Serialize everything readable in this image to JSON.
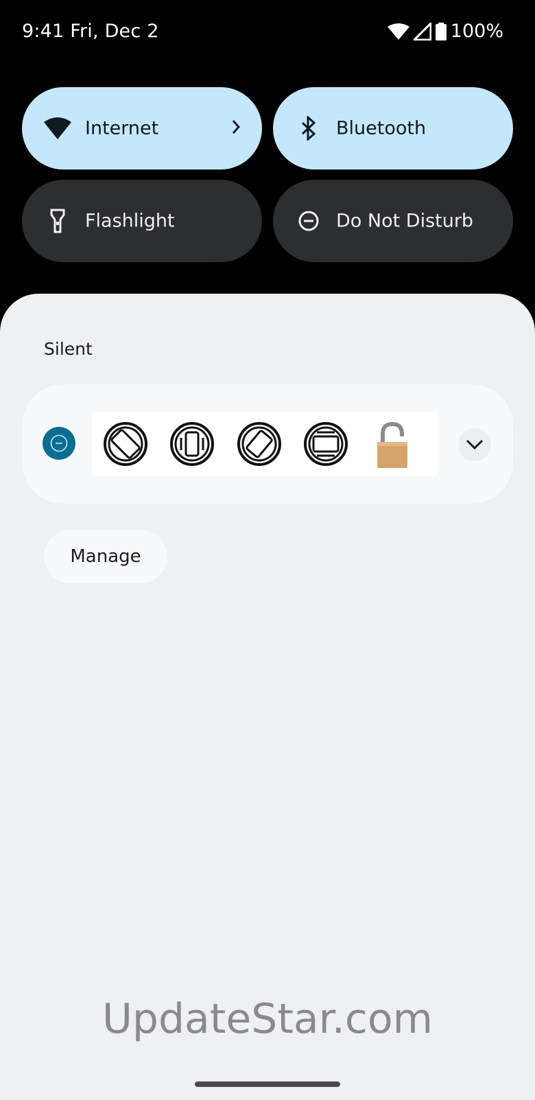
{
  "status_bar": {
    "time": "9:41",
    "date": "Fri, Dec 2",
    "battery": "100%"
  },
  "quick_settings": [
    {
      "label": "Internet",
      "state": "on",
      "icon": "wifi-icon",
      "has_chevron": true
    },
    {
      "label": "Bluetooth",
      "state": "on",
      "icon": "bluetooth-icon"
    },
    {
      "label": "Flashlight",
      "state": "off",
      "icon": "flashlight-icon"
    },
    {
      "label": "Do Not Disturb",
      "state": "off",
      "icon": "do-not-disturb-icon"
    }
  ],
  "notifications": {
    "section_label": "Silent",
    "card": {
      "app_icon": "do-not-disturb-icon",
      "image_icons": [
        "rotate-icon",
        "vibrate-icon",
        "rotate-alt-icon",
        "screen-icon",
        "padlock-icon"
      ],
      "expand_icon": "chevron-down-icon"
    },
    "manage_label": "Manage"
  },
  "watermark": "UpdateStar.com",
  "colors": {
    "tile_on": "#c5e7fb",
    "tile_off": "#2d2e30",
    "shade_bg": "#eff0f2",
    "app_icon_bg": "#0a6e93"
  }
}
